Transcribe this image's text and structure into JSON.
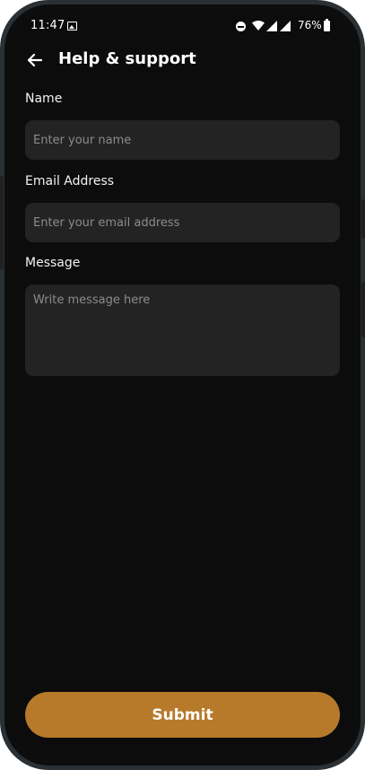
{
  "status_bar": {
    "time": "11:47",
    "battery_percent": "76%",
    "icons": [
      "gallery-icon",
      "dnd-icon",
      "wifi-icon",
      "signal-icon",
      "signal-icon",
      "battery-icon"
    ]
  },
  "header": {
    "title": "Help & support",
    "back_icon": "arrow-left-icon"
  },
  "form": {
    "name": {
      "label": "Name",
      "placeholder": "Enter your name",
      "value": ""
    },
    "email": {
      "label": "Email Address",
      "placeholder": "Enter your email address",
      "value": ""
    },
    "message": {
      "label": "Message",
      "placeholder": "Write message here",
      "value": ""
    }
  },
  "submit": {
    "label": "Submit"
  },
  "colors": {
    "background": "#0b0c0b",
    "input_background": "#222322",
    "accent": "#b77a2b",
    "device_frame": "#2b3034"
  }
}
